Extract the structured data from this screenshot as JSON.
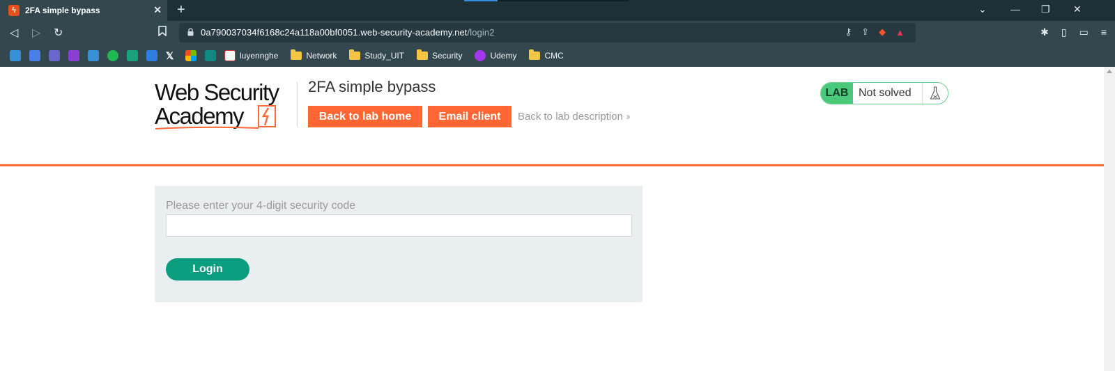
{
  "browser": {
    "tab": {
      "title": "2FA simple bypass",
      "favicon": "portswigger-icon"
    },
    "url": {
      "host": "0a790037034f6168c24a118a00bf0051.web-security-academy.net",
      "path": "/login2"
    },
    "bookmarks": [
      {
        "type": "icon",
        "icon": "edge-icon",
        "color": "#3a8fd6"
      },
      {
        "type": "icon",
        "icon": "translate-icon",
        "color": "#4a7ee8"
      },
      {
        "type": "icon",
        "icon": "teams-icon",
        "color": "#6b66c9"
      },
      {
        "type": "icon",
        "icon": "messenger-icon",
        "color": "#8a3fd1"
      },
      {
        "type": "icon",
        "icon": "edge-icon",
        "color": "#3a8fd6"
      },
      {
        "type": "icon",
        "icon": "spotify-icon",
        "color": "#1db954"
      },
      {
        "type": "icon",
        "icon": "sheets-icon",
        "color": "#1aa37a"
      },
      {
        "type": "icon",
        "icon": "diamond-icon",
        "color": "#2f7de1"
      },
      {
        "type": "icon",
        "icon": "x-icon",
        "color": "#111111"
      },
      {
        "type": "icon",
        "icon": "microsoft-icon",
        "color": "#f25022"
      },
      {
        "type": "icon",
        "icon": "sharepoint-icon",
        "color": "#0f8a82"
      },
      {
        "type": "link",
        "icon": "pattern-icon",
        "label": "luyennghe"
      },
      {
        "type": "folder",
        "label": "Network"
      },
      {
        "type": "folder",
        "label": "Study_UIT"
      },
      {
        "type": "folder",
        "label": "Security"
      },
      {
        "type": "link",
        "icon": "udemy-icon",
        "label": "Udemy"
      },
      {
        "type": "folder",
        "label": "CMC"
      }
    ]
  },
  "header": {
    "logo_line1": "Web Security",
    "logo_line2": "Academy",
    "lab_title": "2FA simple bypass",
    "back_to_lab_home": "Back to lab home",
    "email_client": "Email client",
    "back_to_description": "Back to lab description",
    "lab_badge": {
      "label": "LAB",
      "status": "Not solved"
    }
  },
  "form": {
    "label": "Please enter your 4-digit security code",
    "code_value": "",
    "login_button": "Login"
  },
  "colors": {
    "brand_orange": "#ff6633",
    "login_green": "#0a9e7f",
    "lab_green": "#4ac97a"
  }
}
